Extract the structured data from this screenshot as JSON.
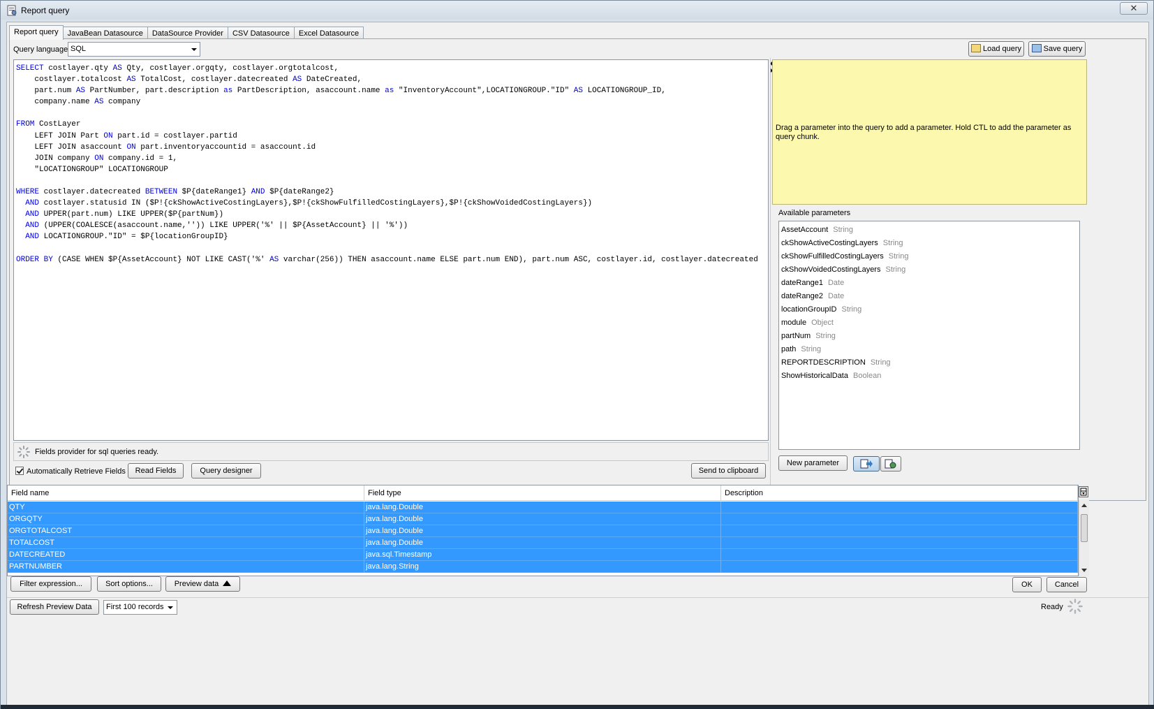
{
  "window": {
    "title": "Report query",
    "close_label": "✕"
  },
  "tabs": [
    {
      "label": "Report query",
      "active": true
    },
    {
      "label": "JavaBean Datasource",
      "active": false
    },
    {
      "label": "DataSource Provider",
      "active": false
    },
    {
      "label": "CSV Datasource",
      "active": false
    },
    {
      "label": "Excel Datasource",
      "active": false
    }
  ],
  "query_language": {
    "label": "Query language",
    "value": "SQL"
  },
  "toolbar": {
    "load_label": "Load query",
    "save_label": "Save query"
  },
  "editor": {
    "lines": [
      [
        [
          "kw",
          "SELECT"
        ],
        [
          "t",
          " costlayer.qty "
        ],
        [
          "kw",
          "AS"
        ],
        [
          "t",
          " Qty, costlayer.orgqty, costlayer.orgtotalcost,"
        ]
      ],
      [
        [
          "t",
          "    costlayer.totalcost "
        ],
        [
          "kw",
          "AS"
        ],
        [
          "t",
          " TotalCost, costlayer.datecreated "
        ],
        [
          "kw",
          "AS"
        ],
        [
          "t",
          " DateCreated,"
        ]
      ],
      [
        [
          "t",
          "    part.num "
        ],
        [
          "kw",
          "AS"
        ],
        [
          "t",
          " PartNumber, part.description "
        ],
        [
          "kw",
          "as"
        ],
        [
          "t",
          " PartDescription, asaccount.name "
        ],
        [
          "kw",
          "as"
        ],
        [
          "t",
          " \"InventoryAccount\",LOCATIONGROUP.\"ID\" "
        ],
        [
          "kw",
          "AS"
        ],
        [
          "t",
          " LOCATIONGROUP_ID,"
        ]
      ],
      [
        [
          "t",
          "    company.name "
        ],
        [
          "kw",
          "AS"
        ],
        [
          "t",
          " company"
        ]
      ],
      [
        [
          "t",
          ""
        ]
      ],
      [
        [
          "kw",
          "FROM"
        ],
        [
          "t",
          " CostLayer"
        ]
      ],
      [
        [
          "t",
          "    LEFT JOIN Part "
        ],
        [
          "kw",
          "ON"
        ],
        [
          "t",
          " part.id = costlayer.partid"
        ]
      ],
      [
        [
          "t",
          "    LEFT JOIN asaccount "
        ],
        [
          "kw",
          "ON"
        ],
        [
          "t",
          " part.inventoryaccountid = asaccount.id"
        ]
      ],
      [
        [
          "t",
          "    JOIN company "
        ],
        [
          "kw",
          "ON"
        ],
        [
          "t",
          " company.id = 1,"
        ]
      ],
      [
        [
          "t",
          "    \"LOCATIONGROUP\" LOCATIONGROUP"
        ]
      ],
      [
        [
          "t",
          ""
        ]
      ],
      [
        [
          "kw",
          "WHERE"
        ],
        [
          "t",
          " costlayer.datecreated "
        ],
        [
          "kw",
          "BETWEEN"
        ],
        [
          "t",
          " $P{dateRange1} "
        ],
        [
          "kw",
          "AND"
        ],
        [
          "t",
          " $P{dateRange2}"
        ]
      ],
      [
        [
          "t",
          "  "
        ],
        [
          "kw",
          "AND"
        ],
        [
          "t",
          " costlayer.statusid IN ($P!{ckShowActiveCostingLayers},$P!{ckShowFulfilledCostingLayers},$P!{ckShowVoidedCostingLayers})"
        ]
      ],
      [
        [
          "t",
          "  "
        ],
        [
          "kw",
          "AND"
        ],
        [
          "t",
          " UPPER(part.num) LIKE UPPER($P{partNum})"
        ]
      ],
      [
        [
          "t",
          "  "
        ],
        [
          "kw",
          "AND"
        ],
        [
          "t",
          " (UPPER(COALESCE(asaccount.name,'')) LIKE UPPER('%' || $P{AssetAccount} || '%'))"
        ]
      ],
      [
        [
          "t",
          "  "
        ],
        [
          "kw",
          "AND"
        ],
        [
          "t",
          " LOCATIONGROUP.\"ID\" = $P{locationGroupID}"
        ]
      ],
      [
        [
          "t",
          ""
        ]
      ],
      [
        [
          "kw",
          "ORDER BY"
        ],
        [
          "t",
          " (CASE WHEN $P{AssetAccount} NOT LIKE CAST('%' "
        ],
        [
          "kw",
          "AS"
        ],
        [
          "t",
          " varchar(256)) THEN asaccount.name ELSE part.num END), part.num ASC, costlayer.id, costlayer.datecreated"
        ]
      ]
    ]
  },
  "status": {
    "fields_provider": "Fields provider for sql queries ready.",
    "auto_retrieve_label": "Automatically Retrieve Fields",
    "auto_retrieve_checked": true
  },
  "actions": {
    "read_fields": "Read Fields",
    "query_designer": "Query designer",
    "send_clipboard": "Send to clipboard",
    "new_parameter": "New parameter"
  },
  "help": {
    "text": "Drag a parameter into the query to add a parameter. Hold CTL to add the parameter as query chunk."
  },
  "parameters": {
    "label": "Available parameters",
    "items": [
      {
        "name": "AssetAccount",
        "type": "String"
      },
      {
        "name": "ckShowActiveCostingLayers",
        "type": "String"
      },
      {
        "name": "ckShowFulfilledCostingLayers",
        "type": "String"
      },
      {
        "name": "ckShowVoidedCostingLayers",
        "type": "String"
      },
      {
        "name": "dateRange1",
        "type": "Date"
      },
      {
        "name": "dateRange2",
        "type": "Date"
      },
      {
        "name": "locationGroupID",
        "type": "String"
      },
      {
        "name": "module",
        "type": "Object"
      },
      {
        "name": "partNum",
        "type": "String"
      },
      {
        "name": "path",
        "type": "String"
      },
      {
        "name": "REPORTDESCRIPTION",
        "type": "String"
      },
      {
        "name": "ShowHistoricalData",
        "type": "Boolean"
      }
    ]
  },
  "fields": {
    "headers": [
      "Field name",
      "Field type",
      "Description"
    ],
    "rows": [
      {
        "name": "QTY",
        "type": "java.lang.Double",
        "desc": ""
      },
      {
        "name": "ORGQTY",
        "type": "java.lang.Double",
        "desc": ""
      },
      {
        "name": "ORGTOTALCOST",
        "type": "java.lang.Double",
        "desc": ""
      },
      {
        "name": "TOTALCOST",
        "type": "java.lang.Double",
        "desc": ""
      },
      {
        "name": "DATECREATED",
        "type": "java.sql.Timestamp",
        "desc": ""
      },
      {
        "name": "PARTNUMBER",
        "type": "java.lang.String",
        "desc": ""
      }
    ]
  },
  "bottom": {
    "filter_label": "Filter expression...",
    "sort_label": "Sort options...",
    "preview_label": "Preview data",
    "ok_label": "OK",
    "cancel_label": "Cancel",
    "refresh_label": "Refresh Preview Data",
    "records_value": "First 100 records",
    "ready_text": "Ready"
  },
  "colors": {
    "selection": "#3399ff",
    "keyword": "#0000dd",
    "help_bg": "#fcf8ae"
  }
}
